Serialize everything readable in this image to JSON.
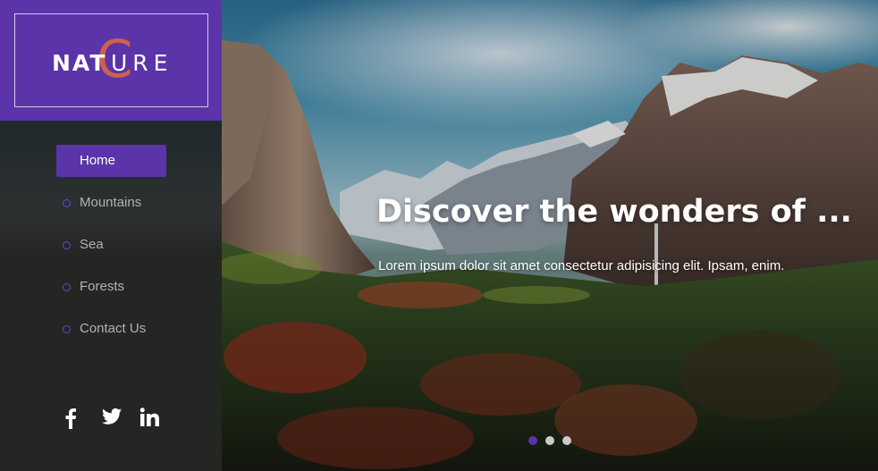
{
  "brand": {
    "logo_part1": "NAT",
    "logo_c": "C",
    "logo_part2": "URE",
    "accent_color": "#5a34a8",
    "logo_c_color": "#e06a3c"
  },
  "nav": {
    "items": [
      {
        "label": "Home",
        "active": true
      },
      {
        "label": "Mountains",
        "active": false
      },
      {
        "label": "Sea",
        "active": false
      },
      {
        "label": "Forests",
        "active": false
      },
      {
        "label": "Contact Us",
        "active": false
      }
    ]
  },
  "social": {
    "icons": [
      "facebook-icon",
      "twitter-icon",
      "linkedin-icon"
    ]
  },
  "hero": {
    "headline": "Discover the wonders of ...",
    "subtext": "Lorem ipsum dolor sit amet consectetur adipisicing elit. Ipsam, enim.",
    "slides": 3,
    "active_slide": 1
  }
}
